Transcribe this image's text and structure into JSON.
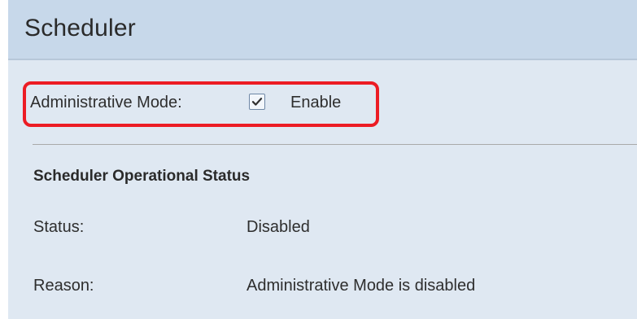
{
  "page": {
    "title": "Scheduler"
  },
  "admin_mode": {
    "label": "Administrative Mode:",
    "checked": true,
    "enable_label": "Enable"
  },
  "operational_status": {
    "heading": "Scheduler Operational Status",
    "status_label": "Status:",
    "status_value": "Disabled",
    "reason_label": "Reason:",
    "reason_value": "Administrative Mode is disabled"
  },
  "colors": {
    "panel_background": "#dfe8f2",
    "title_bar_background": "#c7d8ea",
    "highlight_border": "#ec1c24"
  },
  "icons": {
    "checkbox_check": "check-icon"
  }
}
